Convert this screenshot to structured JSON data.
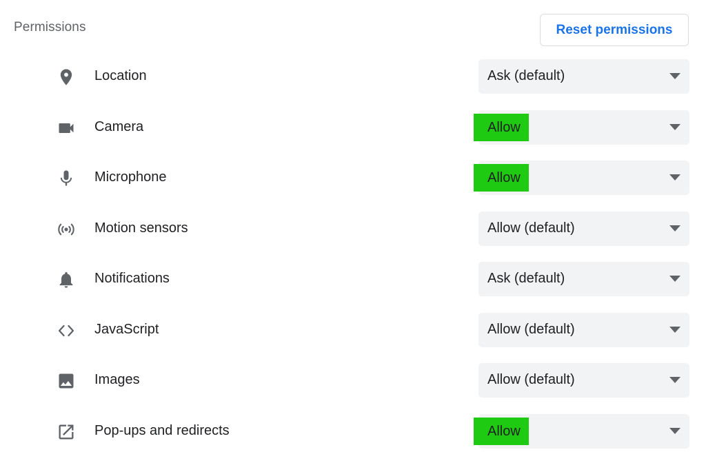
{
  "section": {
    "title": "Permissions",
    "reset_label": "Reset permissions"
  },
  "permissions": [
    {
      "label": "Location",
      "value": "Ask (default)",
      "highlighted": false,
      "icon": "location-pin-icon"
    },
    {
      "label": "Camera",
      "value": "Allow",
      "highlighted": true,
      "icon": "video-camera-icon"
    },
    {
      "label": "Microphone",
      "value": "Allow",
      "highlighted": true,
      "icon": "microphone-icon"
    },
    {
      "label": "Motion sensors",
      "value": "Allow (default)",
      "highlighted": false,
      "icon": "motion-sensors-icon"
    },
    {
      "label": "Notifications",
      "value": "Ask (default)",
      "highlighted": false,
      "icon": "bell-icon"
    },
    {
      "label": "JavaScript",
      "value": "Allow (default)",
      "highlighted": false,
      "icon": "code-brackets-icon"
    },
    {
      "label": "Images",
      "value": "Allow (default)",
      "highlighted": false,
      "icon": "image-icon"
    },
    {
      "label": "Pop-ups and redirects",
      "value": "Allow",
      "highlighted": true,
      "icon": "open-in-new-icon"
    }
  ],
  "colors": {
    "accent": "#1a73e8",
    "highlight": "#1fcb12",
    "select_bg": "#f1f3f4",
    "icon": "#5f6368"
  }
}
